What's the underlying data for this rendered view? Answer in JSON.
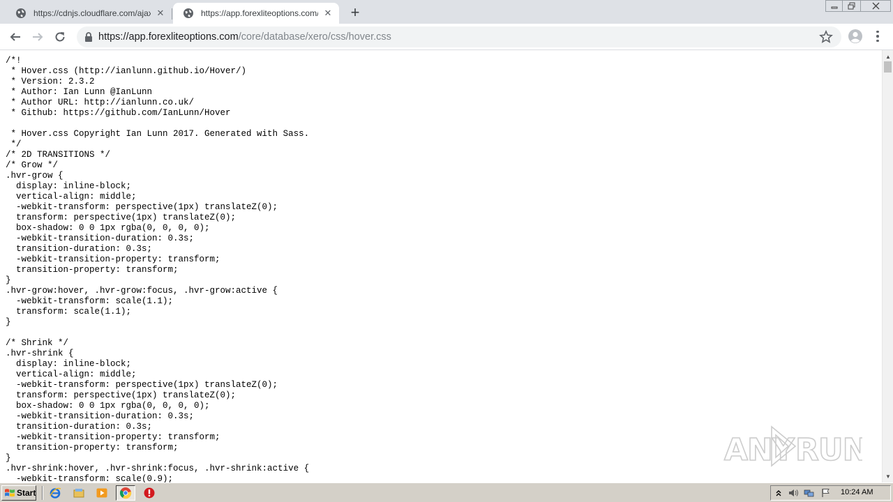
{
  "browser": {
    "tabs": [
      {
        "title": "https://cdnjs.cloudflare.com/ajax/libs/",
        "active": false
      },
      {
        "title": "https://app.forexliteoptions.com/core/",
        "active": true
      }
    ],
    "new_tab_label": "+",
    "address": {
      "host": "https://app.forexliteoptions.com",
      "path": "/core/database/xero/css/hover.css"
    }
  },
  "page": {
    "css_text": "/*!\n * Hover.css (http://ianlunn.github.io/Hover/)\n * Version: 2.3.2\n * Author: Ian Lunn @IanLunn\n * Author URL: http://ianlunn.co.uk/\n * Github: https://github.com/IanLunn/Hover\n\n * Hover.css Copyright Ian Lunn 2017. Generated with Sass.\n */\n/* 2D TRANSITIONS */\n/* Grow */\n.hvr-grow {\n  display: inline-block;\n  vertical-align: middle;\n  -webkit-transform: perspective(1px) translateZ(0);\n  transform: perspective(1px) translateZ(0);\n  box-shadow: 0 0 1px rgba(0, 0, 0, 0);\n  -webkit-transition-duration: 0.3s;\n  transition-duration: 0.3s;\n  -webkit-transition-property: transform;\n  transition-property: transform;\n}\n.hvr-grow:hover, .hvr-grow:focus, .hvr-grow:active {\n  -webkit-transform: scale(1.1);\n  transform: scale(1.1);\n}\n\n/* Shrink */\n.hvr-shrink {\n  display: inline-block;\n  vertical-align: middle;\n  -webkit-transform: perspective(1px) translateZ(0);\n  transform: perspective(1px) translateZ(0);\n  box-shadow: 0 0 1px rgba(0, 0, 0, 0);\n  -webkit-transition-duration: 0.3s;\n  transition-duration: 0.3s;\n  -webkit-transition-property: transform;\n  transition-property: transform;\n}\n.hvr-shrink:hover, .hvr-shrink:focus, .hvr-shrink:active {\n  -webkit-transform: scale(0.9);"
  },
  "watermark": {
    "text_left": "ANY",
    "text_right": "RUN"
  },
  "taskbar": {
    "start_label": "Start",
    "clock": "10:24 AM",
    "pinned_icons": [
      "ie-icon",
      "explorer-icon",
      "media-player-icon",
      "chrome-icon",
      "stop-icon"
    ]
  },
  "colors": {
    "tabstrip_bg": "#dee1e6",
    "omnibox_bg": "#f1f3f4",
    "url_host": "#202124",
    "url_path": "#80868b",
    "taskbar_bg": "#d4d0c8"
  }
}
